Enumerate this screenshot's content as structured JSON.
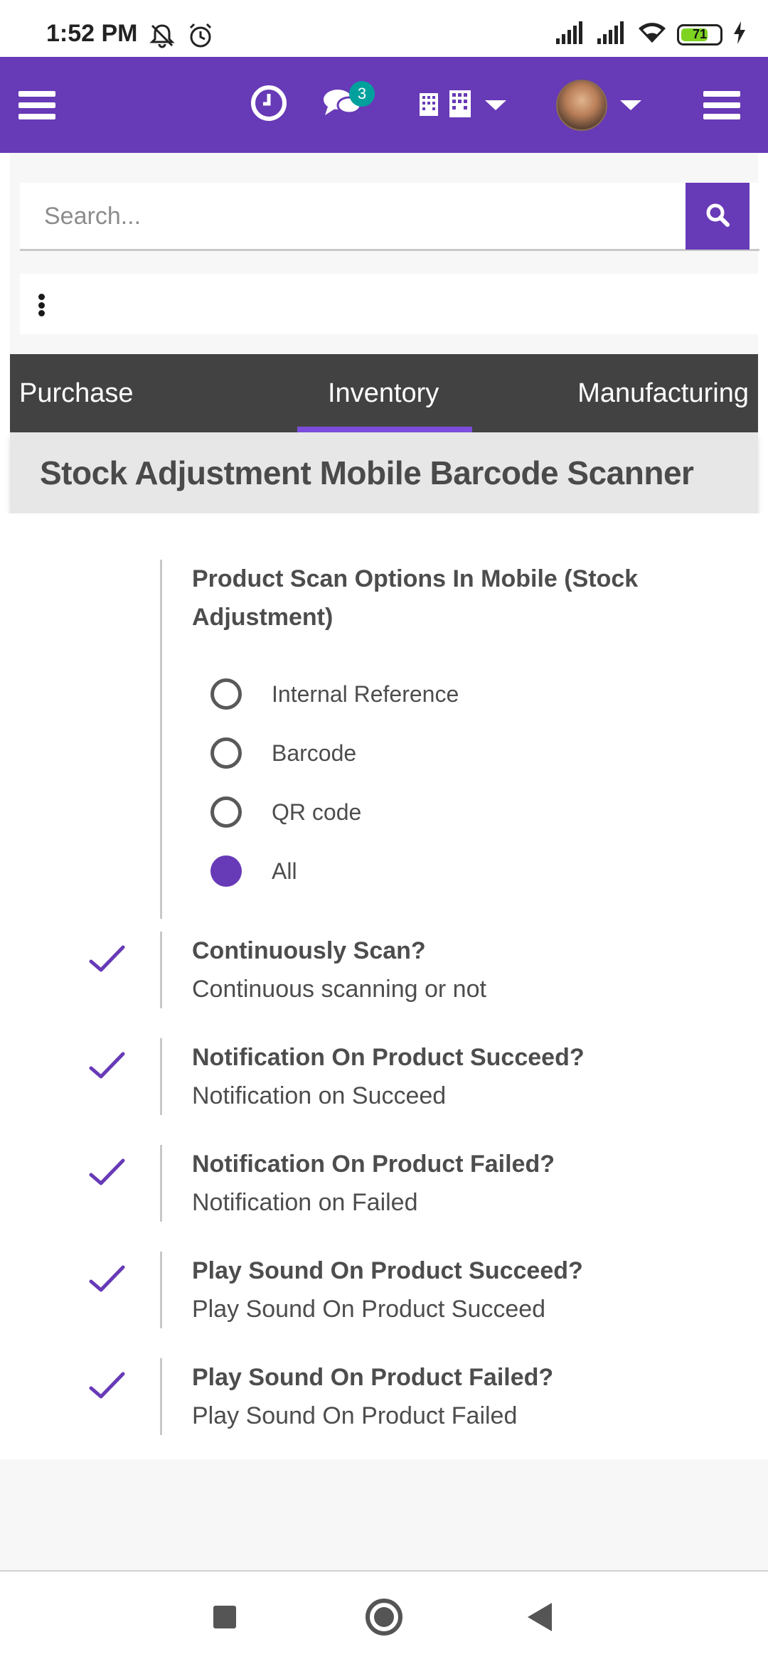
{
  "status_bar": {
    "time": "1:52 PM",
    "battery": "71",
    "battery_level": 0.71,
    "icons": [
      "mute-notifications-icon",
      "alarm-icon",
      "signal-icon",
      "signal-icon",
      "wifi-icon",
      "charging-icon"
    ]
  },
  "top_nav": {
    "icons": [
      "menu-icon",
      "clock-icon",
      "chat-icon",
      "company-icon",
      "avatar",
      "app-menu-icon"
    ],
    "messages_badge": "3"
  },
  "search": {
    "placeholder": "Search...",
    "value": ""
  },
  "tabs": [
    {
      "label": "Purchase",
      "active": false
    },
    {
      "label": "Inventory",
      "active": true
    },
    {
      "label": "Manufacturing",
      "active": false
    }
  ],
  "page": {
    "title": "Stock Adjustment Mobile Barcode Scanner"
  },
  "scan_options": {
    "title": "Product Scan Options In Mobile (Stock Adjustment)",
    "options": [
      {
        "label": "Internal Reference",
        "selected": false
      },
      {
        "label": "Barcode",
        "selected": false
      },
      {
        "label": "QR code",
        "selected": false
      },
      {
        "label": "All",
        "selected": true
      }
    ]
  },
  "settings": [
    {
      "title": "Continuously Scan?",
      "description": "Continuous scanning or not",
      "checked": true
    },
    {
      "title": "Notification On Product Succeed?",
      "description": "Notification on Succeed",
      "checked": true
    },
    {
      "title": "Notification On Product Failed?",
      "description": "Notification on Failed",
      "checked": true
    },
    {
      "title": "Play Sound On Product Succeed?",
      "description": "Play Sound On Product Succeed",
      "checked": true
    },
    {
      "title": "Play Sound On Product Failed?",
      "description": "Play Sound On Product Failed",
      "checked": true
    }
  ],
  "colors": {
    "primary": "#673ab7",
    "tab_bar": "#424242",
    "badge": "#00a09d",
    "title_bar": "#e7e7e7"
  }
}
